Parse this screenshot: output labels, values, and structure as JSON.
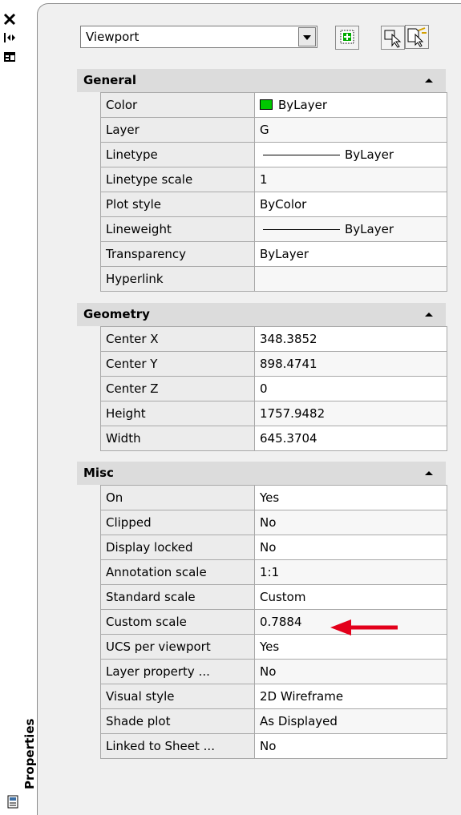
{
  "palette": {
    "title": "Properties"
  },
  "toolbar": {
    "selection_value": "Viewport"
  },
  "sections": [
    {
      "title": "General",
      "rows": [
        {
          "name": "Color",
          "value": "ByLayer",
          "swatch": "#00c800"
        },
        {
          "name": "Layer",
          "value": "G"
        },
        {
          "name": "Linetype",
          "value": "ByLayer",
          "line": true
        },
        {
          "name": "Linetype scale",
          "value": "1"
        },
        {
          "name": "Plot style",
          "value": "ByColor"
        },
        {
          "name": "Lineweight",
          "value": "ByLayer",
          "line": true
        },
        {
          "name": "Transparency",
          "value": "ByLayer"
        },
        {
          "name": "Hyperlink",
          "value": ""
        }
      ]
    },
    {
      "title": "Geometry",
      "rows": [
        {
          "name": "Center X",
          "value": "348.3852"
        },
        {
          "name": "Center Y",
          "value": "898.4741"
        },
        {
          "name": "Center Z",
          "value": "0"
        },
        {
          "name": "Height",
          "value": "1757.9482"
        },
        {
          "name": "Width",
          "value": "645.3704"
        }
      ]
    },
    {
      "title": "Misc",
      "rows": [
        {
          "name": "On",
          "value": "Yes"
        },
        {
          "name": "Clipped",
          "value": "No"
        },
        {
          "name": "Display locked",
          "value": "No"
        },
        {
          "name": "Annotation scale",
          "value": "1:1"
        },
        {
          "name": "Standard scale",
          "value": "Custom"
        },
        {
          "name": "Custom scale",
          "value": "0.7884"
        },
        {
          "name": "UCS per viewport",
          "value": "Yes"
        },
        {
          "name": "Layer property ...",
          "value": "No"
        },
        {
          "name": "Visual style",
          "value": "2D Wireframe"
        },
        {
          "name": "Shade plot",
          "value": "As Displayed"
        },
        {
          "name": "Linked to Sheet ...",
          "value": "No"
        }
      ]
    }
  ],
  "icons": {
    "close": "close-icon",
    "autohide": "auto-hide-icon",
    "settings": "properties-menu-icon",
    "quickselect": "quick-select-icon",
    "selectobjects": "select-objects-icon",
    "pickadd": "pickadd-toggle-icon",
    "annotation_arrow_color": "#e3001b"
  }
}
